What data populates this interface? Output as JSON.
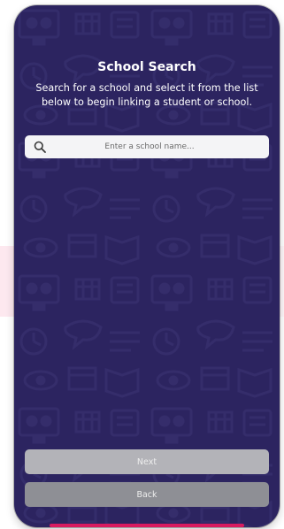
{
  "page": {
    "title": "School Search",
    "subtitle": "Search for a school and select it from the list below to begin linking a student or school."
  },
  "search": {
    "placeholder": "Enter a school name...",
    "value": ""
  },
  "buttons": {
    "next_label": "Next",
    "back_label": "Back"
  },
  "icons": {
    "search": "search-icon"
  },
  "colors": {
    "background": "#2c2460",
    "accent": "#d81b60",
    "next_button": "#b3b3b8",
    "back_button": "#8e8f95"
  }
}
